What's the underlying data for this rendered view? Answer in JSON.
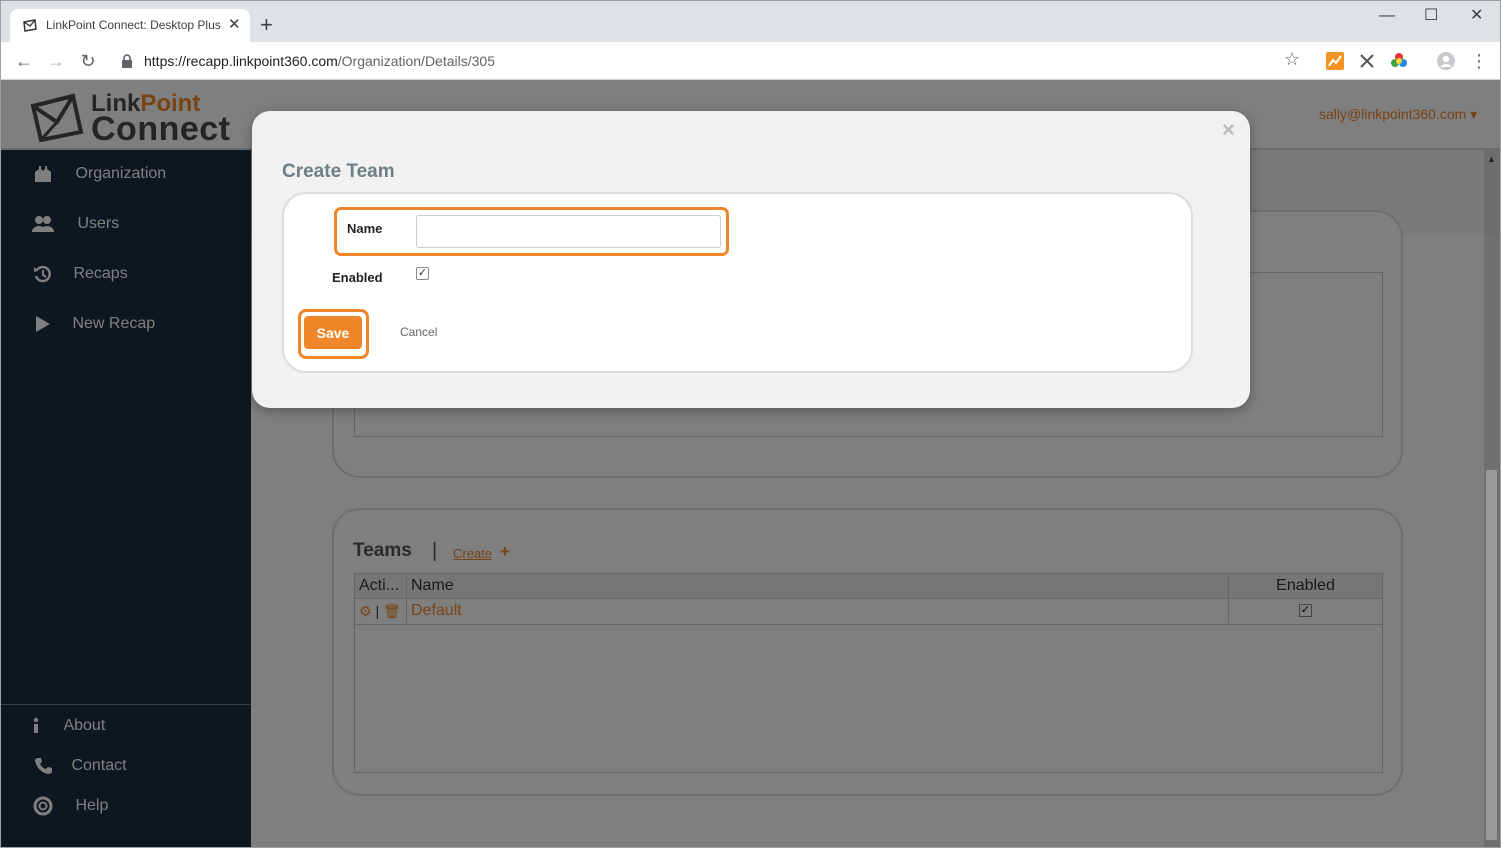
{
  "browser": {
    "tab_title": "LinkPoint Connect: Desktop Plus",
    "tab_close": "✕",
    "new_tab": "+",
    "url_host": "https://recapp.linkpoint360.com",
    "url_path": "/Organization/Details/305",
    "window_controls": {
      "minimize": "—",
      "maximize": "☐",
      "close": "✕"
    }
  },
  "app": {
    "logo_line1_a": "Link",
    "logo_line1_b": "Point",
    "logo_line2": "Connect",
    "user_menu": "sally@linkpoint360.com ▾",
    "accent": "#f0862a",
    "sidebar_bg": "#1d2f3e"
  },
  "sidebar": {
    "items": [
      {
        "label": "Organization",
        "icon": "organization-icon"
      },
      {
        "label": "Users",
        "icon": "users-icon"
      },
      {
        "label": "Recaps",
        "icon": "history-icon"
      },
      {
        "label": "New Recap",
        "icon": "play-icon"
      }
    ],
    "bottom_items": [
      {
        "label": "About",
        "icon": "info-icon"
      },
      {
        "label": "Contact",
        "icon": "phone-icon"
      },
      {
        "label": "Help",
        "icon": "lifebuoy-icon"
      }
    ]
  },
  "teams": {
    "title": "Teams",
    "separator": "|",
    "create_label": "Create",
    "create_plus": "+",
    "columns": [
      "Acti...",
      "Name",
      "Enabled"
    ],
    "rows": [
      {
        "name": "Default",
        "enabled": true
      }
    ],
    "row_separator": "|"
  },
  "modal": {
    "title": "Create Team",
    "close": "×",
    "name_label": "Name",
    "name_value": "",
    "enabled_label": "Enabled",
    "enabled_checked": true,
    "save_label": "Save",
    "cancel_label": "Cancel"
  }
}
